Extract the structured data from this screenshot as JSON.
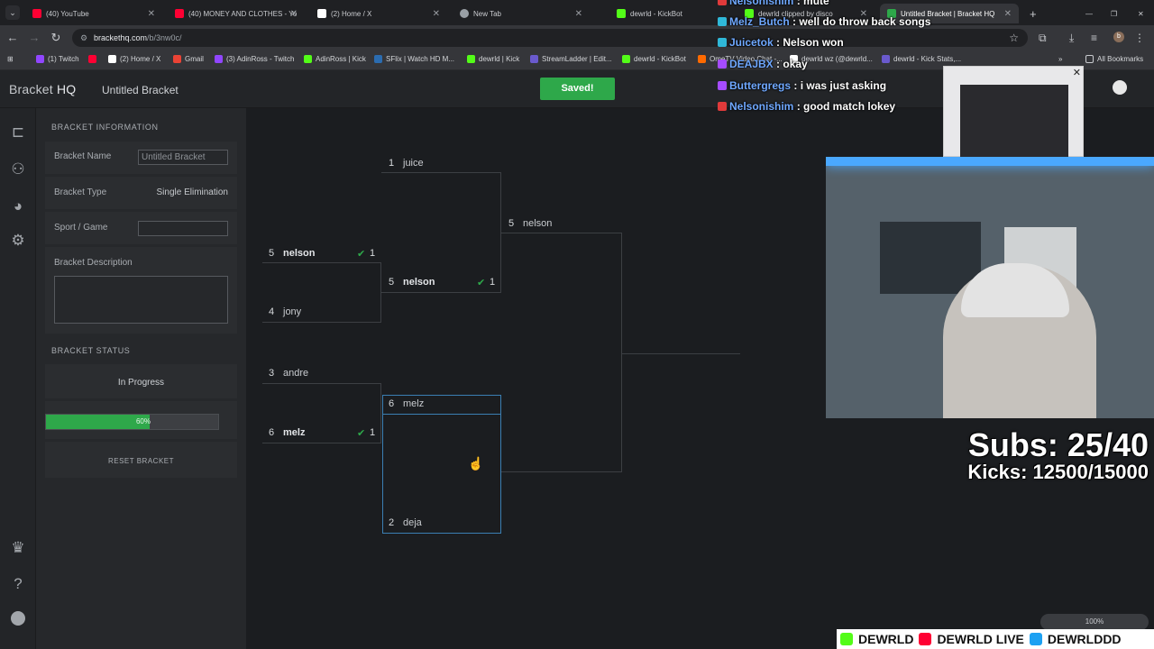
{
  "browser": {
    "tabs": [
      {
        "label": "(40) YouTube",
        "color": "#ff0033"
      },
      {
        "label": "(40) MONEY AND CLOTHES - Yo",
        "color": "#ff0033"
      },
      {
        "label": "(2) Home / X",
        "color": "#ffffff"
      },
      {
        "label": "New Tab",
        "color": "#9aa0a6"
      },
      {
        "label": "dewrld - KickBot",
        "color": "#53fc18"
      },
      {
        "label": "dewrld clipped by disco",
        "color": "#53fc18"
      },
      {
        "label": "Untitled Bracket | Bracket HQ",
        "color": "#2ea84a"
      }
    ],
    "url_host": "brackethq.com",
    "url_path": "/b/3nw0c/",
    "bookmarks": [
      {
        "label": "(1) Twitch",
        "color": "#9146ff"
      },
      {
        "label": "",
        "color": "#ff0033"
      },
      {
        "label": "(2) Home / X",
        "color": "#ffffff"
      },
      {
        "label": "Gmail",
        "color": "#ea4335"
      },
      {
        "label": "(3) AdinRoss - Twitch",
        "color": "#9146ff"
      },
      {
        "label": "AdinRoss | Kick",
        "color": "#53fc18"
      },
      {
        "label": "SFlix | Watch HD M...",
        "color": "#2b6cb0"
      },
      {
        "label": "dewrld | Kick",
        "color": "#53fc18"
      },
      {
        "label": "StreamLadder | Edit...",
        "color": "#6a5acd"
      },
      {
        "label": "dewrld - KickBot",
        "color": "#53fc18"
      },
      {
        "label": "OmeTV Video Chat -...",
        "color": "#ff6a00"
      },
      {
        "label": "dewrld wz (@dewrld...",
        "color": "#ffffff"
      },
      {
        "label": "dewrld - Kick Stats,...",
        "color": "#6a5acd"
      }
    ],
    "all_bookmarks": "All Bookmarks",
    "zoom": "100%"
  },
  "app": {
    "brand_light": "Bracket",
    "brand_bold": "HQ",
    "title": "Untitled Bracket",
    "saved_label": "Saved!"
  },
  "sidebar": {
    "info_heading": "BRACKET INFORMATION",
    "name_label": "Bracket Name",
    "name_value": "Untitled Bracket",
    "type_label": "Bracket Type",
    "type_value": "Single Elimination",
    "sport_label": "Sport / Game",
    "sport_value": "",
    "desc_label": "Bracket Description",
    "status_heading": "BRACKET STATUS",
    "status_value": "In Progress",
    "progress": 0.6,
    "progress_label": "60%",
    "reset_label": "RESET BRACKET"
  },
  "bracket": {
    "round1": [
      {
        "seed": "5",
        "name": "nelson",
        "winner": true,
        "score": "1"
      },
      {
        "seed": "4",
        "name": "jony",
        "winner": false,
        "score": ""
      },
      {
        "seed": "3",
        "name": "andre",
        "winner": false,
        "score": ""
      },
      {
        "seed": "6",
        "name": "melz",
        "winner": true,
        "score": "1"
      }
    ],
    "round2": [
      {
        "seed": "1",
        "name": "juice",
        "winner": false,
        "score": ""
      },
      {
        "seed": "5",
        "name": "nelson",
        "winner": true,
        "score": "1"
      },
      {
        "seed": "6",
        "name": "melz",
        "winner": false,
        "score": ""
      },
      {
        "seed": "2",
        "name": "deja",
        "winner": false,
        "score": ""
      }
    ],
    "round3": [
      {
        "seed": "5",
        "name": "nelson",
        "winner": false,
        "score": ""
      }
    ]
  },
  "stream": {
    "chat": [
      {
        "user": "Nelsonishim",
        "msg": "mute",
        "badge": "#e03a3a"
      },
      {
        "user": "Melz_Butch",
        "msg": "well do throw back songs",
        "badge": "#2fb8d8"
      },
      {
        "user": "Juicetok",
        "msg": "Nelson won",
        "badge": "#2fb8d8"
      },
      {
        "user": "DEAJBX",
        "msg": "okay",
        "badge": "#a64cff"
      },
      {
        "user": "Buttergregs",
        "msg": "i was just asking",
        "badge": "#a64cff"
      },
      {
        "user": "Nelsonishim",
        "msg": "good match lokey",
        "badge": "#e03a3a"
      }
    ],
    "subs_text": "Subs: 25/40",
    "kicks_text": "Kicks: 12500/15000",
    "socials": [
      {
        "label": "DEWRLD",
        "color": "#53fc18"
      },
      {
        "label": "DEWRLD LIVE",
        "color": "#ff0033"
      },
      {
        "label": "DEWRLDDD",
        "color": "#1da1f2"
      }
    ]
  }
}
